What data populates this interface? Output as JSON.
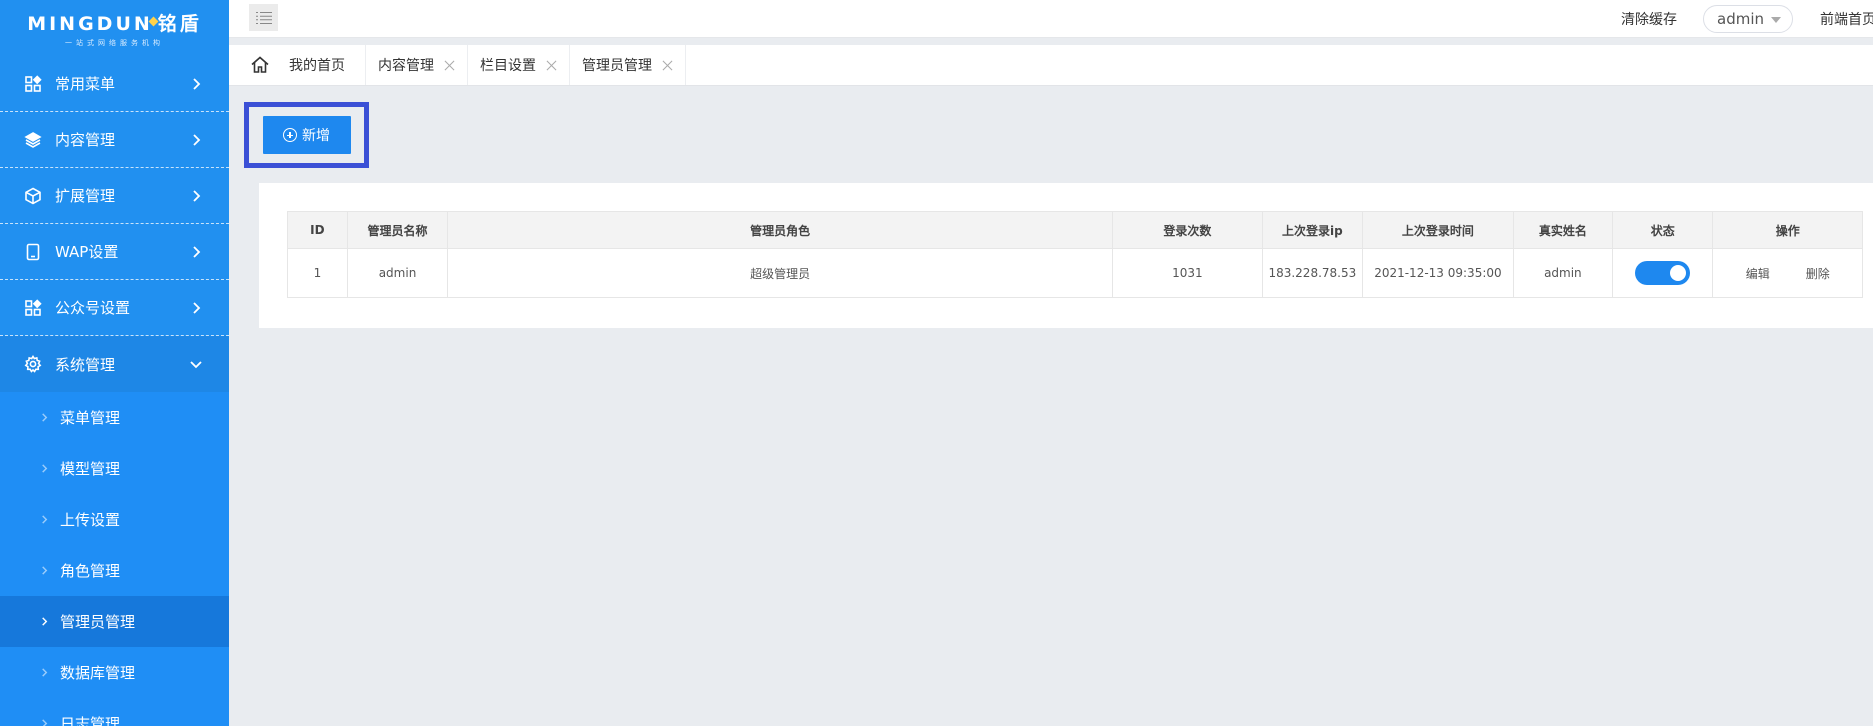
{
  "logo": {
    "brand": "MINGDUN",
    "chinese": "铭盾",
    "tagline": "一站式网络服务机构"
  },
  "sidebar": {
    "menus": [
      {
        "label": "常用菜单",
        "icon": "grid-icon"
      },
      {
        "label": "内容管理",
        "icon": "layers-icon"
      },
      {
        "label": "扩展管理",
        "icon": "cube-icon"
      },
      {
        "label": "WAP设置",
        "icon": "tablet-icon"
      },
      {
        "label": "公众号设置",
        "icon": "grid-icon"
      },
      {
        "label": "系统管理",
        "icon": "gear-icon",
        "open": true
      }
    ],
    "submenu": [
      {
        "label": "菜单管理"
      },
      {
        "label": "模型管理"
      },
      {
        "label": "上传设置"
      },
      {
        "label": "角色管理"
      },
      {
        "label": "管理员管理",
        "active": true
      },
      {
        "label": "数据库管理"
      },
      {
        "label": "日志管理"
      }
    ]
  },
  "header": {
    "clear_cache": "清除缓存",
    "user": "admin",
    "frontend": "前端首页"
  },
  "tabs": {
    "home": "我的首页",
    "items": [
      {
        "label": "内容管理"
      },
      {
        "label": "栏目设置"
      },
      {
        "label": "管理员管理"
      }
    ]
  },
  "toolbar": {
    "add_label": "新增"
  },
  "table": {
    "columns": [
      "ID",
      "管理员名称",
      "管理员角色",
      "登录次数",
      "上次登录ip",
      "上次登录时间",
      "真实姓名",
      "状态",
      "操作"
    ],
    "rows": [
      {
        "id": "1",
        "name": "admin",
        "role": "超级管理员",
        "login_count": "1031",
        "last_ip": "183.228.78.53",
        "last_time": "2021-12-13 09:35:00",
        "real_name": "admin",
        "status_on": true,
        "edit": "编辑",
        "delete": "删除"
      }
    ]
  },
  "colors": {
    "sidebar": "#2190f0",
    "accent": "#1e88ef",
    "highlight_frame": "#3b50d6"
  }
}
